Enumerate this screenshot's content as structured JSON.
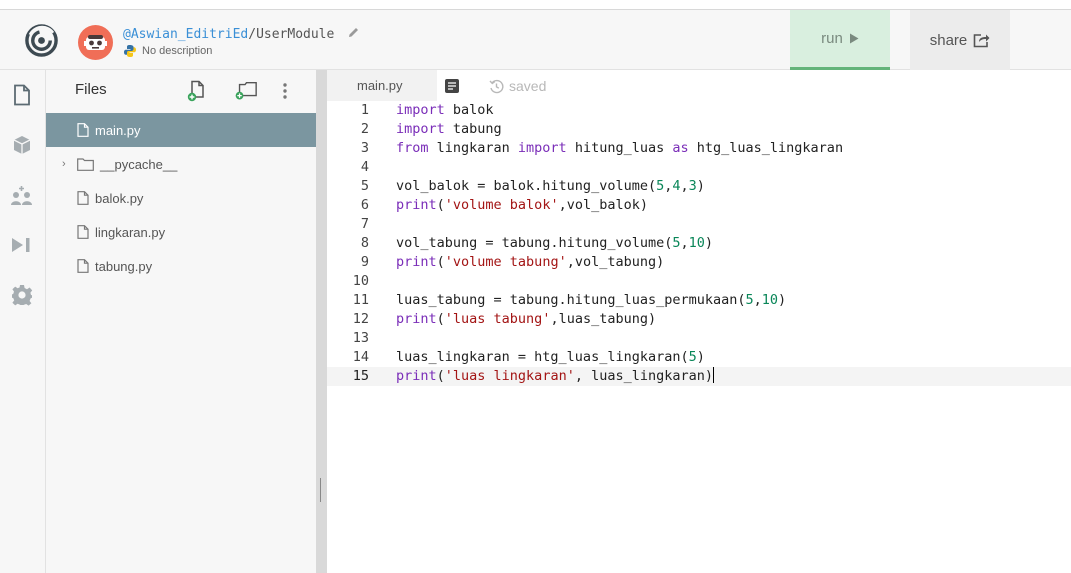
{
  "header": {
    "owner": "@Aswian_EditriEd",
    "separator": "/",
    "repl_name": "UserModule",
    "description": "No description",
    "run_label": "run",
    "share_label": "share"
  },
  "sidebar": {
    "icons": [
      "files-icon",
      "packages-icon",
      "multiplayer-icon",
      "debugger-icon",
      "settings-icon"
    ]
  },
  "files": {
    "title": "Files",
    "items": [
      {
        "label": "main.py",
        "type": "file",
        "active": true
      },
      {
        "label": "__pycache__",
        "type": "folder",
        "active": false
      },
      {
        "label": "balok.py",
        "type": "file",
        "active": false
      },
      {
        "label": "lingkaran.py",
        "type": "file",
        "active": false
      },
      {
        "label": "tabung.py",
        "type": "file",
        "active": false
      }
    ]
  },
  "editor": {
    "tab_label": "main.py",
    "saved_label": "saved",
    "current_line": 15,
    "lines": [
      "import balok",
      "import tabung",
      "from lingkaran import hitung_luas as htg_luas_lingkaran",
      "",
      "vol_balok = balok.hitung_volume(5,4,3)",
      "print('volume balok',vol_balok)",
      "",
      "vol_tabung = tabung.hitung_volume(5,10)",
      "print('volume tabung',vol_tabung)",
      "",
      "luas_tabung = tabung.hitung_luas_permukaan(5,10)",
      "print('luas tabung',luas_tabung)",
      "",
      "luas_lingkaran = htg_luas_lingkaran(5)",
      "print('luas lingkaran', luas_lingkaran)"
    ]
  },
  "colors": {
    "run_bg": "#d9efdf",
    "run_border": "#64b47a",
    "active_file_bg": "#7b96a0",
    "owner_link": "#3a8fd6",
    "keyword": "#7a2db8",
    "string": "#a31515",
    "number": "#098658"
  }
}
